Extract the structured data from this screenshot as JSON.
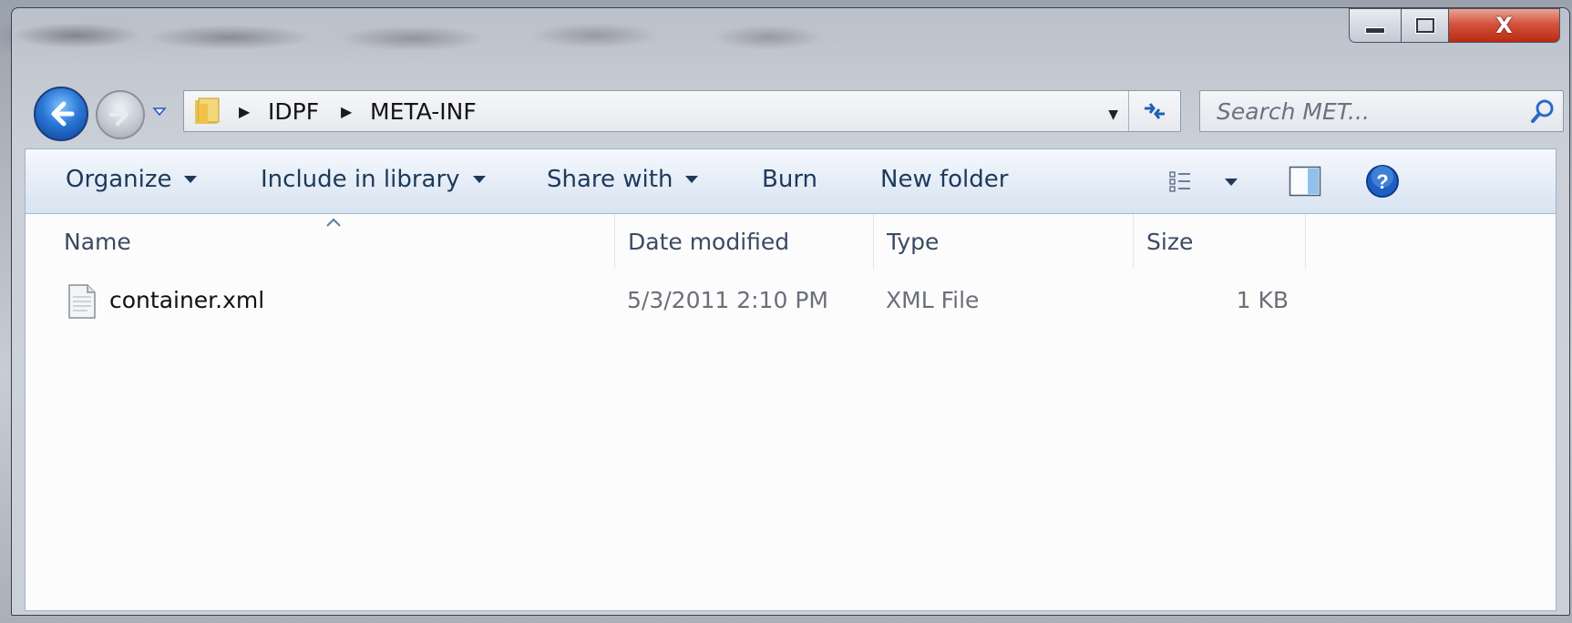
{
  "address_bar": {
    "crumbs": [
      "IDPF",
      "META-INF"
    ]
  },
  "search": {
    "placeholder": "Search MET..."
  },
  "toolbar": {
    "organize": "Organize",
    "include_in_library": "Include in library",
    "share_with": "Share with",
    "burn": "Burn",
    "new_folder": "New folder"
  },
  "columns": {
    "name": "Name",
    "date_modified": "Date modified",
    "type": "Type",
    "size": "Size"
  },
  "files": [
    {
      "name": "container.xml",
      "date_modified": "5/3/2011 2:10 PM",
      "type": "XML File",
      "size": "1 KB"
    }
  ],
  "caption": {
    "close_label": "X"
  },
  "colors": {
    "toolbar_text": "#1e395b",
    "accent_blue": "#2b77d6",
    "close_red": "#c7402a"
  }
}
